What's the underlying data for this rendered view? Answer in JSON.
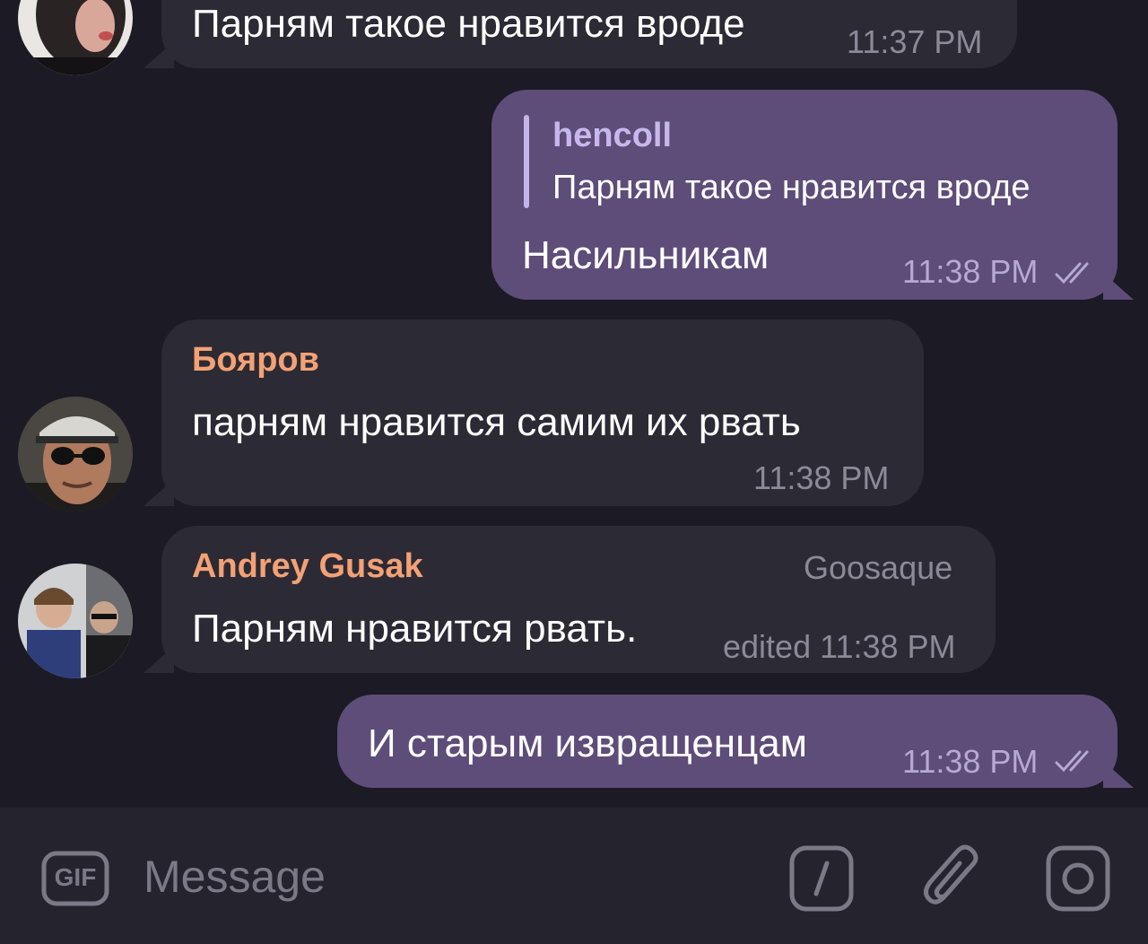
{
  "messages": [
    {
      "id": "m1",
      "direction": "incoming",
      "text": "Парням такое нравится вроде",
      "time": "11:37 PM"
    },
    {
      "id": "m2",
      "direction": "outgoing",
      "reply_to": {
        "sender": "hencoll",
        "text": "Парням такое нравится вроде"
      },
      "text": "Насильникам",
      "time": "11:38 PM",
      "status": "read"
    },
    {
      "id": "m3",
      "direction": "incoming",
      "sender": "Бояров",
      "text": "парням нравится самим их рвать",
      "time": "11:38 PM"
    },
    {
      "id": "m4",
      "direction": "incoming",
      "sender": "Andrey Gusak",
      "sender_tag": "Goosaque",
      "text": "Парням нравится рвать.",
      "time": "edited 11:38 PM"
    },
    {
      "id": "m5",
      "direction": "outgoing",
      "text": "И старым извращенцам",
      "time": "11:38 PM",
      "status": "read"
    }
  ],
  "composer": {
    "placeholder": "Message",
    "gif_label": "GIF",
    "icons": [
      "gif-icon",
      "slash-command-icon",
      "paperclip-icon",
      "camera-icon"
    ]
  },
  "colors": {
    "background": "#1c1a24",
    "incoming_bubble": "#2c2a35",
    "outgoing_bubble": "#5e4c79",
    "sender_name": "#f3a175",
    "reply_name": "#c7b7ea"
  }
}
